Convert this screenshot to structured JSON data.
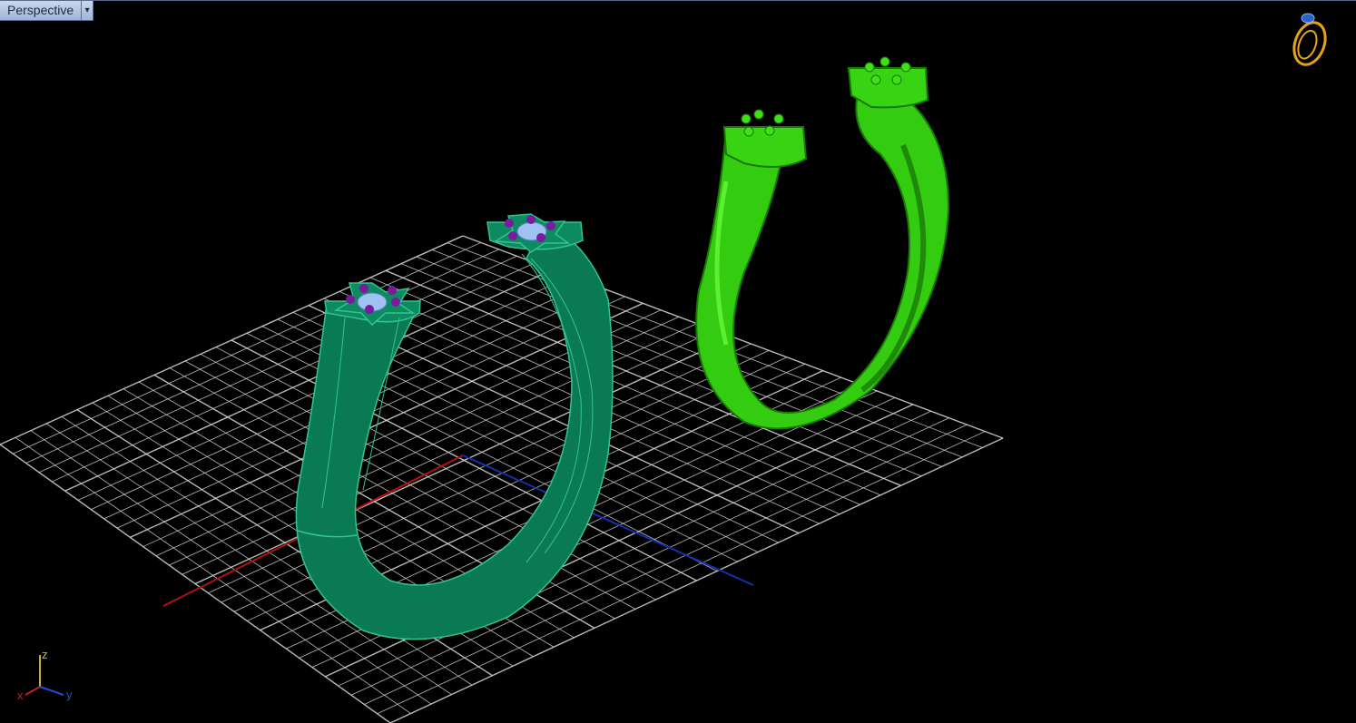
{
  "viewport": {
    "name": "Perspective",
    "background": "#000000"
  },
  "icons": {
    "view_menu": "chevron-down-icon",
    "app_logo": "ring-logo-icon",
    "axis_gizmo": "axis-gizmo-icon"
  },
  "axis_gizmo": {
    "x_label": "x",
    "y_label": "y",
    "z_label": "z"
  },
  "colors": {
    "grid_line": "#d8d8d8",
    "x_axis": "#b01010",
    "y_axis": "#1030b0",
    "ring_left": "#0a7a55",
    "ring_right": "#33cc10",
    "prongs": "#7a1aa0",
    "gem": "#9ec3f0",
    "logo": "#e8a21a"
  }
}
